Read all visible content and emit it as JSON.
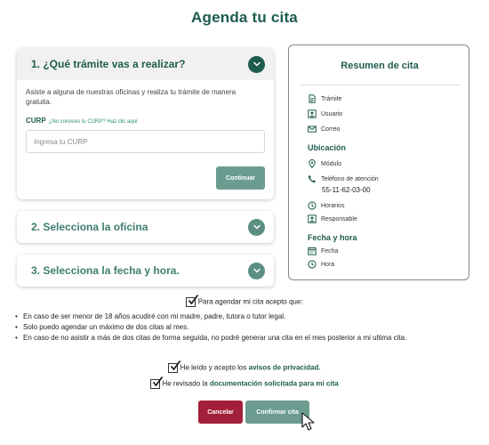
{
  "page": {
    "title": "Agenda tu cita"
  },
  "steps": {
    "step1": {
      "title": "1. ¿Qué trámite vas a realizar?",
      "intro": "Asiste a alguna de nuestras oficinas y realiza tu trámite de manera gratuita.",
      "curp_label": "CURP",
      "curp_link": "¿No conoces tu CURP? Haz clic aquí",
      "curp_placeholder": "Ingresa tu CURP",
      "curp_value": "",
      "continue_label": "Continuar"
    },
    "step2": {
      "title": "2. Selecciona la oficina"
    },
    "step3": {
      "title": "3. Selecciona la fecha y hora."
    }
  },
  "summary": {
    "title": "Resumen de cita",
    "items": [
      {
        "icon": "document-icon",
        "label": "Trámite"
      },
      {
        "icon": "user-card-icon",
        "label": "Usuario"
      },
      {
        "icon": "mail-icon",
        "label": "Correo"
      }
    ],
    "location": {
      "heading": "Ubicación",
      "module_label": "Módulo",
      "phone_label": "Teléfono de atención",
      "phone_value": "55-11-62-03-00",
      "hours_label": "Horarios",
      "manager_label": "Responsable"
    },
    "datetime": {
      "heading": "Fecha y hora",
      "date_label": "Fecha",
      "time_label": "Hora"
    }
  },
  "consent": {
    "intro": "Para agendar mi cita acepto que:",
    "rules": [
      "En caso de ser menor de 18 años acudiré con mi madre, padre, tutora o tutor legal.",
      "Solo puedo agendar un máximo de dos citas al mes.",
      "En caso de no asistir a más de dos citas de forma seguida, no podré generar una cita en el mes posterior a mi ultima cita."
    ],
    "privacy_prefix": "He leído y acepto los",
    "privacy_link": "avisos de privacidad.",
    "docs_prefix": "He revisado la",
    "docs_link": "documentación solicitada para mi cita"
  },
  "actions": {
    "cancel_label": "Cancelar",
    "confirm_label": "Confirmar cita"
  },
  "colors": {
    "primary": "#1e5b4f",
    "secondary_button": "#6b9c8f",
    "cancel": "#a3203a"
  }
}
